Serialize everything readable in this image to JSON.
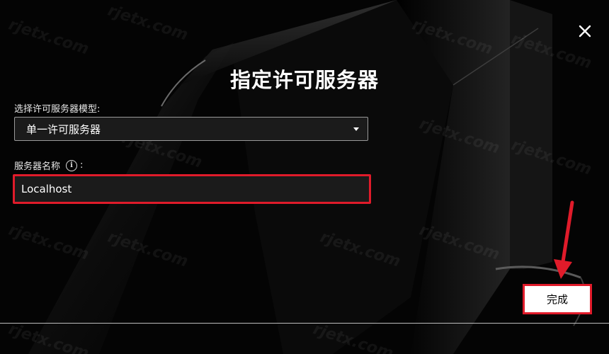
{
  "dialog": {
    "title": "指定许可服务器",
    "close_icon": "close-icon"
  },
  "form": {
    "model_label": "选择许可服务器模型:",
    "model_value": "单一许可服务器",
    "name_label": "服务器名称",
    "info_icon_glyph": "i",
    "name_value": "Localhost"
  },
  "footer": {
    "done_label": "完成"
  },
  "watermark": {
    "text": "rjetx.com"
  },
  "colors": {
    "highlight": "#e01b2a",
    "background": "#050505"
  }
}
